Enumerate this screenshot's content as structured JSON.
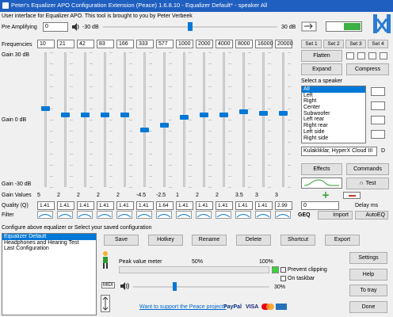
{
  "window": {
    "title": "Peter's Equalizer APO Configuration Extension (Peace) 1.6.8.10 - Equalizer Default* - speaker All"
  },
  "header": {
    "subtitle": "User interface for Equalizer APO. This tool is brought to you by Peter Verbeek"
  },
  "pre_amp": {
    "label": "Pre Amplifying",
    "value": "0",
    "min_label": "-30 dB",
    "max_label": "30 dB",
    "level": 0.5
  },
  "freq": {
    "label": "Frequencies",
    "values": [
      "10",
      "21",
      "42",
      "83",
      "166",
      "333",
      "577",
      "1000",
      "2000",
      "4000",
      "8000",
      "16000",
      "20000"
    ]
  },
  "sets": [
    "Set 1",
    "Set 2",
    "Set 3",
    "Set 4"
  ],
  "gain_axis": {
    "top": "Gain 30 dB",
    "mid": "Gain 0 dB",
    "bottom": "Gain -30 dB"
  },
  "gains": [
    {
      "value": "5",
      "level": 5
    },
    {
      "value": "2",
      "level": 2
    },
    {
      "value": "2",
      "level": 2
    },
    {
      "value": "2",
      "level": 2
    },
    {
      "value": "2",
      "level": 2
    },
    {
      "value": "-4.5",
      "level": -4.5
    },
    {
      "value": "-2.5",
      "level": -2.5
    },
    {
      "value": "1",
      "level": 1
    },
    {
      "value": "2",
      "level": 2
    },
    {
      "value": "2",
      "level": 2
    },
    {
      "value": "3.5",
      "level": 3.5
    },
    {
      "value": "3",
      "level": 3
    },
    {
      "value": "3",
      "level": 3
    }
  ],
  "gain_values_label": "Gain Values",
  "quality_label": "Quality (Q)",
  "quality": [
    "1.41",
    "1.41",
    "1.41",
    "1.41",
    "1.41",
    "1.41",
    "1.64",
    "1.41",
    "1.41",
    "1.41",
    "1.41",
    "1.41",
    "2.99"
  ],
  "filter_label": "Filter",
  "buttons": {
    "flatten": "Flatten",
    "expand": "Expand",
    "compress": "Compress",
    "effects": "Effects",
    "commands": "Commands",
    "test": "Test",
    "delay": "Delay ms",
    "delay_value": "0",
    "geq": "GEQ",
    "import": "Import",
    "autoeq": "AutoEQ",
    "save": "Save",
    "hotkey": "Hotkey",
    "rename": "Rename",
    "delete": "Delete",
    "shortcut": "Shortcut",
    "export": "Export",
    "settings": "Settings",
    "help": "Help",
    "to_tray": "To tray",
    "done": "Done"
  },
  "speaker": {
    "label": "Select a speaker",
    "items": [
      "All",
      "Left",
      "Right",
      "Center",
      "Subwoofer",
      "Left rear",
      "Right rear",
      "Left side",
      "Right side"
    ],
    "selected": "All",
    "device": "Kulaklıklar, HyperX Cloud III"
  },
  "config": {
    "label": "Configure above equalizer or Select your saved configuration",
    "items": [
      "Equalizer Default",
      "Headphones and Hearing Test",
      "Last Configuration"
    ],
    "selected": "Equalizer Default"
  },
  "peak": {
    "label": "Peak value meter",
    "p50": "50%",
    "p100": "100%",
    "prevent_clipping": "Prevent clipping",
    "on_taskbar": "On taskbar",
    "volume_pct": "30%",
    "volume_level": 0.3
  },
  "footer": {
    "support": "Want to support the Peace project?",
    "paypal": "PayPal",
    "cards": "VISA"
  },
  "midi": "MIDI",
  "colors": {
    "accent": "#0078d7",
    "title": "#1f5fbf",
    "power": "#3cb043",
    "plus": "#2e9b2e",
    "minus": "#c0392b"
  }
}
